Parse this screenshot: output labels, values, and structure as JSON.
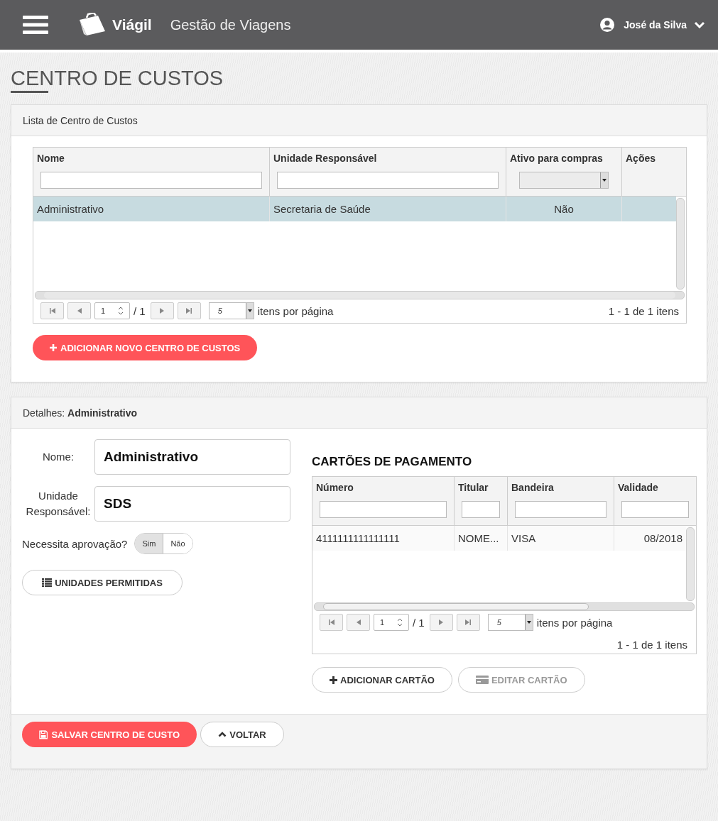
{
  "header": {
    "brand": "Viágil",
    "subtitle": "Gestão de Viagens",
    "user": "José da Silva"
  },
  "page_title": "CENTRO DE CUSTOS",
  "list_panel": {
    "title": "Lista de Centro de Custos",
    "grid": {
      "columns": [
        {
          "label": "Nome",
          "kind": "text"
        },
        {
          "label": "Unidade Responsável",
          "kind": "text"
        },
        {
          "label": "Ativo para compras",
          "kind": "select"
        },
        {
          "label": "Ações",
          "kind": "plain"
        }
      ],
      "rows": [
        {
          "cells": [
            "Administrativo",
            "Secretaria de Saúde",
            "Não",
            ""
          ],
          "selected": true
        }
      ],
      "pager": {
        "page": "1",
        "total": "/ 1",
        "page_size": "5",
        "per_page_label": "itens por página",
        "summary": "1 - 1 de 1 itens"
      }
    },
    "add_button": "ADICIONAR NOVO CENTRO DE CUSTOS"
  },
  "details": {
    "title": "Detalhes: **Administrativo**",
    "fields": [
      {
        "label": "Nome:",
        "value": "Administrativo"
      },
      {
        "label": "Unidade Responsável:",
        "value": "SDS"
      }
    ],
    "approval": {
      "label": "Necessita aprovação?",
      "options": [
        {
          "label": "Sim",
          "selected": true
        },
        {
          "label": "Não",
          "selected": false
        }
      ]
    },
    "units_button": "UNIDADES PERMITIDAS",
    "cards": {
      "title": "CARTÕES DE PAGAMENTO",
      "grid": {
        "columns": [
          {
            "label": "Número",
            "kind": "text"
          },
          {
            "label": "Titular",
            "kind": "text"
          },
          {
            "label": "Bandeira",
            "kind": "text"
          },
          {
            "label": "Validade",
            "kind": "text"
          }
        ],
        "rows": [
          {
            "cells": [
              "4111111111111111",
              "NOME...",
              "VISA",
              "08/2018"
            ],
            "selected": false
          }
        ],
        "pager": {
          "page": "1",
          "total": "/ 1",
          "page_size": "5",
          "per_page_label": "itens por página",
          "summary": "1 - 1 de 1 itens"
        }
      },
      "buttons": [
        {
          "label": "ADICIONAR CARTÃO",
          "kind": "add",
          "disabled": false
        },
        {
          "label": "EDITAR CARTÃO",
          "kind": "edit",
          "disabled": true
        }
      ]
    }
  },
  "footer": {
    "save_button": "SALVAR CENTRO DE CUSTO",
    "back_button": "VOLTAR"
  }
}
